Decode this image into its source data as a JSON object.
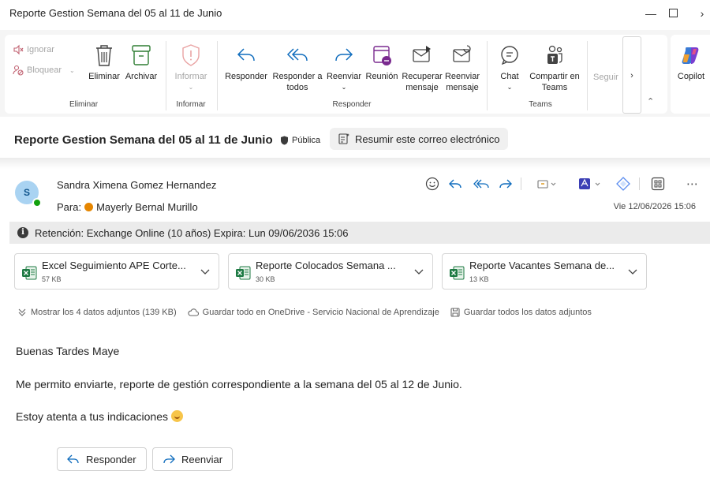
{
  "window": {
    "title": "Reporte Gestion Semana del 05 al 11 de Junio"
  },
  "ribbon": {
    "ignore_label": "Ignorar",
    "block_label": "Bloquear",
    "delete_label": "Eliminar",
    "archive_label": "Archivar",
    "report_label": "Informar",
    "reply_label": "Responder",
    "reply_all_label": "Responder a todos",
    "forward_label": "Reenviar",
    "meeting_label": "Reunión",
    "recover_label": "Recuperar mensaje",
    "resend_label": "Reenviar mensaje",
    "chat_label": "Chat",
    "share_teams_label": "Compartir en Teams",
    "follow_label": "Seguir",
    "copilot_label": "Copilot",
    "groups": {
      "delete": "Eliminar",
      "report": "Informar",
      "respond": "Responder",
      "teams": "Teams"
    }
  },
  "message": {
    "subject": "Reporte Gestion Semana del 05 al 11 de Junio",
    "sensitivity": "Pública",
    "summarize_label": "Resumir este correo electrónico",
    "sender_name": "Sandra Ximena Gomez Hernandez",
    "sender_initials": "S",
    "to_prefix": "Para:",
    "to_name": "Mayerly Bernal Murillo",
    "date": "Vie 12/06/2026 15:06",
    "retention": "Retención: Exchange Online (10 años) Expira: Lun 09/06/2036 15:06"
  },
  "attachments": [
    {
      "name": "Excel Seguimiento APE Corte...",
      "size": "57 KB"
    },
    {
      "name": "Reporte Colocados Semana ...",
      "size": "30 KB"
    },
    {
      "name": "Reporte Vacantes Semana de...",
      "size": "13 KB"
    }
  ],
  "attachment_actions": {
    "show_all": "Mostrar los 4 datos adjuntos (139 KB)",
    "save_onedrive": "Guardar todo en OneDrive - Servicio Nacional de Aprendizaje",
    "save_all": "Guardar todos los datos adjuntos"
  },
  "body": {
    "greeting": "Buenas Tardes Maye",
    "line1": "Me permito enviarte, reporte de gestión correspondiente a la semana del 05 al 12 de Junio.",
    "line2": "Estoy atenta a tus indicaciones"
  },
  "footer": {
    "reply_label": "Responder",
    "forward_label": "Reenviar"
  },
  "colors": {
    "accent": "#0f6cbd",
    "teams_purple": "#5b5fc7",
    "meeting_purple": "#7a2a8f",
    "presence_green": "#13a10e"
  }
}
